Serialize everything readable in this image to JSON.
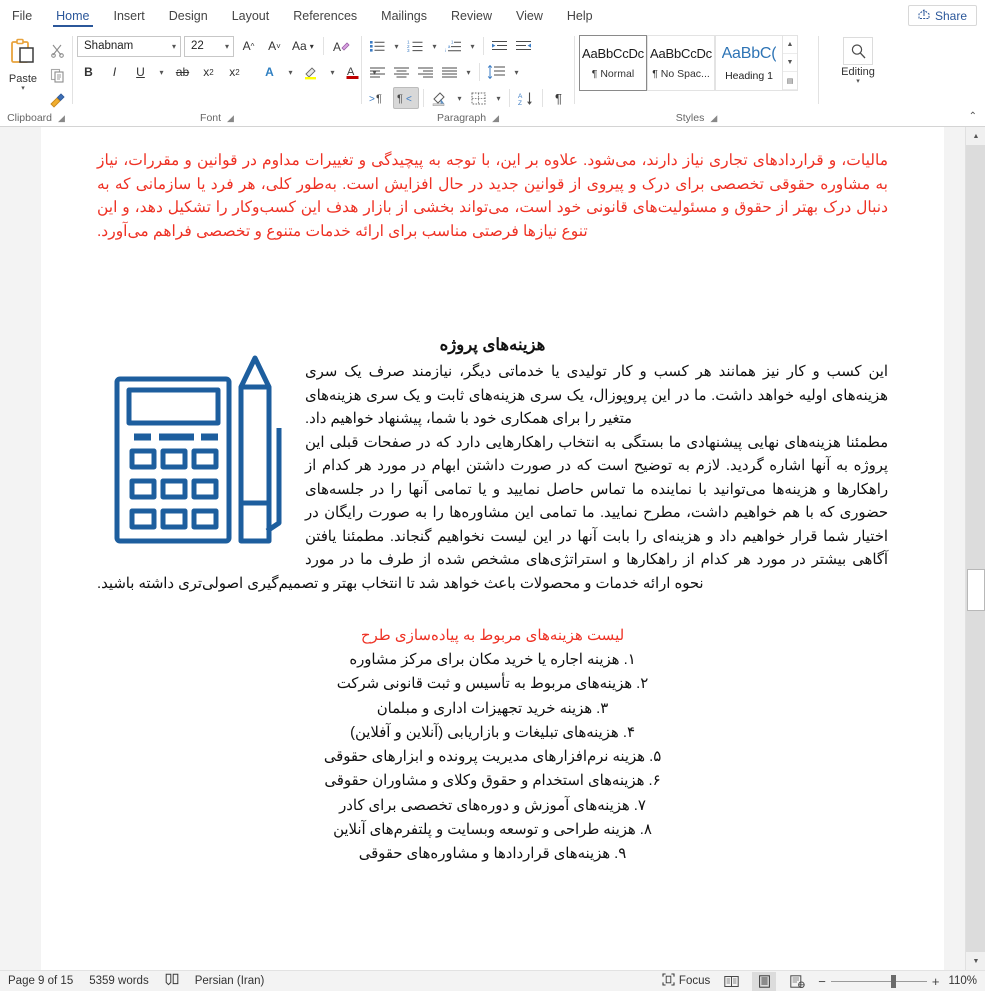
{
  "tabs": [
    {
      "label": "File",
      "active": false
    },
    {
      "label": "Home",
      "active": true
    },
    {
      "label": "Insert",
      "active": false
    },
    {
      "label": "Design",
      "active": false
    },
    {
      "label": "Layout",
      "active": false
    },
    {
      "label": "References",
      "active": false
    },
    {
      "label": "Mailings",
      "active": false
    },
    {
      "label": "Review",
      "active": false
    },
    {
      "label": "View",
      "active": false
    },
    {
      "label": "Help",
      "active": false
    }
  ],
  "share": {
    "label": "Share",
    "icon": "share-icon"
  },
  "ribbon": {
    "clipboard": {
      "group_label": "Clipboard",
      "paste_label": "Paste",
      "cut_icon": "scissors-icon",
      "copy_icon": "copy-icon",
      "format_painter_icon": "format-painter-icon",
      "dialog_launcher": "⌐"
    },
    "font": {
      "group_label": "Font",
      "font_name": "Shabnam",
      "font_size": "22",
      "grow_font": "A",
      "shrink_font": "A",
      "change_case": "Aa",
      "clear_formatting": "A",
      "bold": "B",
      "italic": "I",
      "underline": "U",
      "strikethrough": "ab",
      "subscript": "x",
      "superscript": "x",
      "text_effects": "A",
      "highlight": "A",
      "font_color": "A",
      "font_color_hex": "#c00000",
      "highlight_hex": "#ffff00"
    },
    "paragraph": {
      "group_label": "Paragraph",
      "bullets": "bullets-icon",
      "numbering": "numbering-icon",
      "multilevel": "multilevel-list-icon",
      "decrease_indent": "decrease-indent-icon",
      "increase_indent": "increase-indent-icon",
      "align_left": "align-left-icon",
      "align_center": "align-center-icon",
      "align_right": "align-right-icon",
      "justify": "justify-icon",
      "line_spacing": "line-spacing-icon",
      "ltr": "ltr-icon",
      "rtl": "rtl-icon",
      "rtl_active": true,
      "shading": "shading-icon",
      "borders": "borders-icon",
      "sort": "sort-icon",
      "show_marks": "pilcrow-icon"
    },
    "styles": {
      "group_label": "Styles",
      "items": [
        {
          "sample": "AaBbCcDc",
          "name": "¶ Normal",
          "selected": true
        },
        {
          "sample": "AaBbCcDc",
          "name": "¶ No Spac...",
          "selected": false
        },
        {
          "sample": "AaBbC(",
          "name": "Heading 1",
          "selected": false
        }
      ]
    },
    "editing": {
      "group_label": "",
      "label": "Editing",
      "icon": "search-icon"
    },
    "collapse_icon": "chevron-up-icon"
  },
  "document": {
    "red_paragraph": "مالیات، و قراردادهای تجاری نیاز دارند، می‌شود. علاوه بر این، با توجه به پیچیدگی و تغییرات مداوم در قوانین و مقررات، نیاز به مشاوره حقوقی تخصصی برای درک و پیروی از قوانین جدید در حال افزایش است. به‌طور کلی، هر فرد یا سازمانی که به دنبال درک بهتر از حقوق و مسئولیت‌های قانونی خود است، می‌تواند بخشی از بازار هدف این کسب‌وکار را تشکیل دهد، و این تنوع نیازها فرصتی مناسب برای ارائه خدمات متنوع و تخصصی فراهم می‌آورد.",
    "section_heading": "هزینه‌های پروژه",
    "paragraph_1": "این کسب و کار نیز همانند هر کسب و کار تولیدی یا خدماتی دیگر، نیازمند صرف یک سری هزینه‌های اولیه خواهد داشت. ما در این پروپوزال، یک سری هزینه‌های ثابت و یک سری هزینه‌های متغیر را برای همکاری خود با شما، پیشنهاد خواهیم داد.",
    "paragraph_2": "مطمئنا هزینه‌های نهایی پیشنهادی ما بستگی به انتخاب راهکارهایی دارد که در صفحات قبلی این پروژه به آنها اشاره گردید. لازم به توضیح است که در صورت داشتن ابهام در مورد هر کدام از راهکارها و هزینه‌ها می‌توانید با نماینده ما تماس حاصل نمایید و یا تمامی آنها را در جلسه‌های حضوری که با هم خواهیم داشت، مطرح نمایید. ما تمامی این مشاوره‌ها را به صورت رایگان در اختیار شما قرار خواهیم داد و هزینه‌ای را بابت آنها در این لیست نخواهیم گنجاند. مطمئنا یافتن آگاهی بیشتر در مورد هر کدام از راهکارها و استراتژی‌های مشخص شده از طرف ما در مورد نحوه ارائه خدمات و محصولات باعث خواهد شد تا انتخاب بهتر و تصمیم‌گیری اصولی‌تری داشته باشید.",
    "list_heading": "لیست هزینه‌های مربوط به پیاده‌سازی طرح",
    "list_items": [
      "۱. هزینه اجاره یا خرید مکان برای مرکز مشاوره",
      "۲. هزینه‌های مربوط به تأسیس و ثبت قانونی شرکت",
      "۳. هزینه خرید تجهیزات اداری و مبلمان",
      "۴. هزینه‌های تبلیغات و بازاریابی (آنلاین و آفلاین)",
      "۵. هزینه نرم‌افزارهای مدیریت پرونده و ابزارهای حقوقی",
      "۶. هزینه‌های استخدام و حقوق وکلای و مشاوران حقوقی",
      "۷. هزینه‌های آموزش و دوره‌های تخصصی برای کادر",
      "۸. هزینه طراحی و توسعه وبسایت و پلتفرم‌های آنلاین",
      "۹. هزینه‌های قراردادها و مشاوره‌های حقوقی"
    ],
    "figure": {
      "name": "calculator-pencil-illustration",
      "color": "#1d5e9e"
    },
    "text_color_red": "#ee3124"
  },
  "status_bar": {
    "page": "Page 9 of 15",
    "words": "5359 words",
    "proofing_icon": "proofing-icon",
    "language": "Persian (Iran)",
    "focus": "Focus",
    "focus_icon": "focus-icon",
    "view_read": "read-mode-icon",
    "view_print": "print-layout-icon",
    "view_web": "web-layout-icon",
    "zoom_out": "−",
    "zoom_in": "+",
    "zoom_level": "110%"
  }
}
